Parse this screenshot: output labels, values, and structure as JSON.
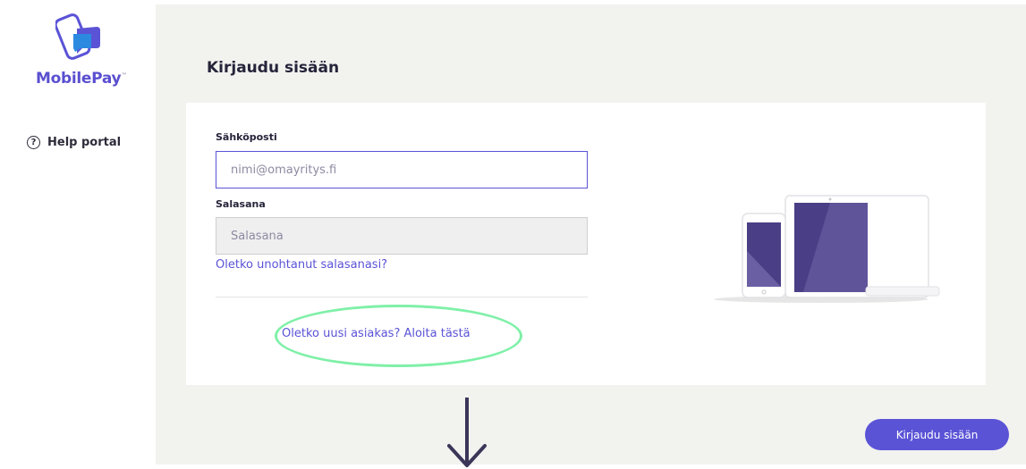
{
  "sidebar": {
    "logo_text": "MobilePay",
    "logo_tm": "™",
    "help_label": "Help portal",
    "help_icon_glyph": "?"
  },
  "main": {
    "page_title": "Kirjaudu sisään",
    "login_button_label": "Kirjaudu sisään"
  },
  "form": {
    "email_label": "Sähköposti",
    "email_placeholder": "nimi@omayritys.fi",
    "password_label": "Salasana",
    "password_placeholder": "Salasana",
    "forgot_password_link": "Oletko unohtanut salasanasi?",
    "new_customer_link": "Oletko uusi asiakas? Aloita tästä"
  },
  "colors": {
    "accent": "#5a53d6",
    "background": "#f2f2ef",
    "highlight": "#7ff0a8",
    "arrow": "#3b3658"
  },
  "icons": [
    "mobilepay-logo-icon",
    "help-circle-icon",
    "devices-illustration",
    "arrow-down-icon"
  ]
}
